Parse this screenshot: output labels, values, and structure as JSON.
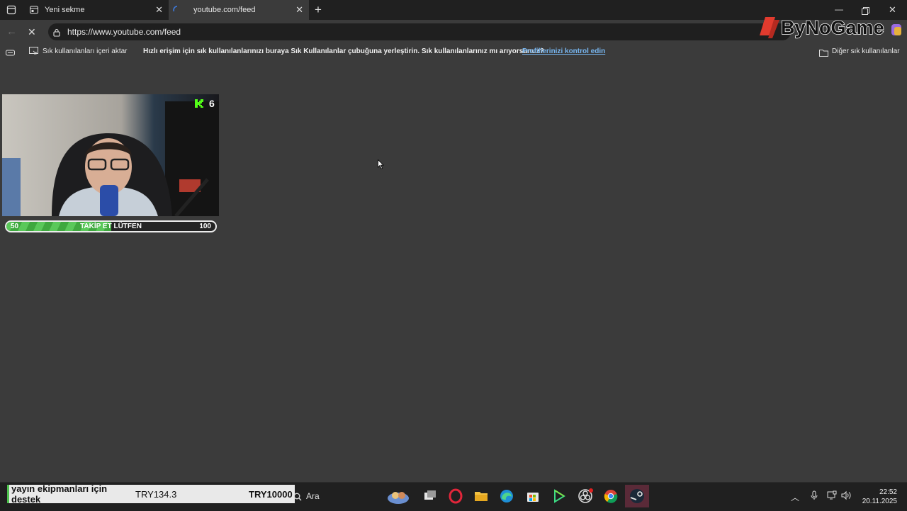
{
  "browser": {
    "tabs": [
      {
        "label": "Yeni sekme",
        "icon": "new-tab-icon"
      },
      {
        "label": "youtube.com/feed",
        "icon": "loading-spinner-icon",
        "active": true
      }
    ],
    "address": "https://www.youtube.com/feed",
    "bookmarks": {
      "import_label": "Sık kullanılanları içeri aktar",
      "hint": "Hızlı erişim için sık kullanılanlarınızı buraya Sık Kullanılanlar çubuğuna yerleştirin. Sık kullanılanlarınız mı arıyorsunuz?",
      "hint_link": "Profillerinizi kontrol edin",
      "other_label": "Diğer sık kullanılanlar"
    }
  },
  "overlay": {
    "logo_text": "ByNoGame",
    "kick_count": "6",
    "progress": {
      "left_value": "50",
      "right_value": "100",
      "label": "TAKİP ET LÜTFEN",
      "fraction": 0.5
    },
    "donation": {
      "text": "yayın ekipmanları için destek",
      "raised": "TRY134.3",
      "goal": "TRY10000"
    }
  },
  "taskbar": {
    "search_placeholder": "Ara",
    "time": "22:52",
    "date": "20.11.2025"
  },
  "colors": {
    "page_bg": "#3b3b3b",
    "tabstrip_bg": "#202020",
    "link": "#77b6f0",
    "kick_green": "#53fc18",
    "progress_green": "#4cbb4c"
  }
}
